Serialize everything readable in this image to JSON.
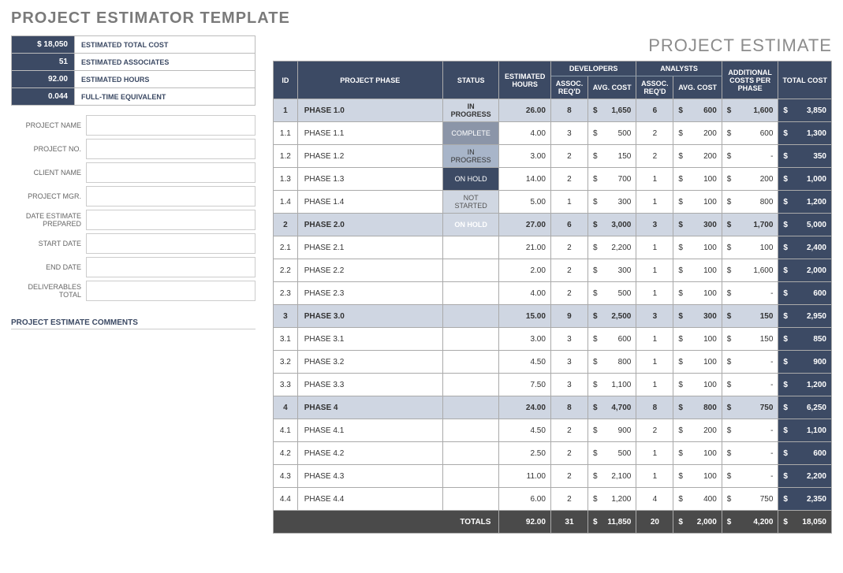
{
  "title": "PROJECT ESTIMATOR TEMPLATE",
  "estimate_title": "PROJECT ESTIMATE",
  "summary": [
    {
      "value": "$      18,050",
      "label": "ESTIMATED TOTAL COST"
    },
    {
      "value": "51",
      "label": "ESTIMATED ASSOCIATES"
    },
    {
      "value": "92.00",
      "label": "ESTIMATED HOURS"
    },
    {
      "value": "0.044",
      "label": "FULL-TIME EQUIVALENT"
    }
  ],
  "info_labels": [
    "PROJECT NAME",
    "PROJECT NO.",
    "CLIENT NAME",
    "PROJECT MGR.",
    "DATE ESTIMATE PREPARED",
    "START DATE",
    "END DATE",
    "DELIVERABLES TOTAL"
  ],
  "comments_label": "PROJECT ESTIMATE COMMENTS",
  "headers": {
    "id": "ID",
    "phase": "PROJECT PHASE",
    "status": "STATUS",
    "est": "ESTIMATED HOURS",
    "dev": "DEVELOPERS",
    "ana": "ANALYSTS",
    "assoc": "ASSOC. REQ'D",
    "avg": "AVG. COST",
    "addl": "ADDITIONAL COSTS PER PHASE",
    "total": "TOTAL COST"
  },
  "rows": [
    {
      "p": 1,
      "id": "1",
      "phase": "PHASE 1.0",
      "status": "IN PROGRESS",
      "scls": "s-inprog",
      "est": "26.00",
      "dassoc": "8",
      "davg": "1,650",
      "aassoc": "6",
      "aavg": "600",
      "addl": "1,600",
      "total": "3,850"
    },
    {
      "id": "1.1",
      "phase": "PHASE 1.1",
      "status": "COMPLETE",
      "scls": "s-complete",
      "est": "4.00",
      "dassoc": "3",
      "davg": "500",
      "aassoc": "2",
      "aavg": "200",
      "addl": "600",
      "total": "1,300"
    },
    {
      "id": "1.2",
      "phase": "PHASE 1.2",
      "status": "IN PROGRESS",
      "scls": "s-inprog",
      "est": "3.00",
      "dassoc": "2",
      "davg": "150",
      "aassoc": "2",
      "aavg": "200",
      "addl": "-",
      "total": "350"
    },
    {
      "id": "1.3",
      "phase": "PHASE 1.3",
      "status": "ON HOLD",
      "scls": "s-hold",
      "est": "14.00",
      "dassoc": "2",
      "davg": "700",
      "aassoc": "1",
      "aavg": "100",
      "addl": "200",
      "total": "1,000"
    },
    {
      "id": "1.4",
      "phase": "PHASE 1.4",
      "status": "NOT STARTED",
      "scls": "s-not",
      "est": "5.00",
      "dassoc": "1",
      "davg": "300",
      "aassoc": "1",
      "aavg": "100",
      "addl": "800",
      "total": "1,200"
    },
    {
      "p": 1,
      "id": "2",
      "phase": "PHASE 2.0",
      "status": "ON HOLD",
      "scls": "s-hold",
      "est": "27.00",
      "dassoc": "6",
      "davg": "3,000",
      "aassoc": "3",
      "aavg": "300",
      "addl": "1,700",
      "total": "5,000"
    },
    {
      "id": "2.1",
      "phase": "PHASE 2.1",
      "status": "",
      "est": "21.00",
      "dassoc": "2",
      "davg": "2,200",
      "aassoc": "1",
      "aavg": "100",
      "addl": "100",
      "total": "2,400"
    },
    {
      "id": "2.2",
      "phase": "PHASE 2.2",
      "status": "",
      "est": "2.00",
      "dassoc": "2",
      "davg": "300",
      "aassoc": "1",
      "aavg": "100",
      "addl": "1,600",
      "total": "2,000"
    },
    {
      "id": "2.3",
      "phase": "PHASE 2.3",
      "status": "",
      "est": "4.00",
      "dassoc": "2",
      "davg": "500",
      "aassoc": "1",
      "aavg": "100",
      "addl": "-",
      "total": "600"
    },
    {
      "p": 1,
      "id": "3",
      "phase": "PHASE 3.0",
      "status": "",
      "est": "15.00",
      "dassoc": "9",
      "davg": "2,500",
      "aassoc": "3",
      "aavg": "300",
      "addl": "150",
      "total": "2,950"
    },
    {
      "id": "3.1",
      "phase": "PHASE 3.1",
      "status": "",
      "est": "3.00",
      "dassoc": "3",
      "davg": "600",
      "aassoc": "1",
      "aavg": "100",
      "addl": "150",
      "total": "850"
    },
    {
      "id": "3.2",
      "phase": "PHASE 3.2",
      "status": "",
      "est": "4.50",
      "dassoc": "3",
      "davg": "800",
      "aassoc": "1",
      "aavg": "100",
      "addl": "-",
      "total": "900"
    },
    {
      "id": "3.3",
      "phase": "PHASE 3.3",
      "status": "",
      "est": "7.50",
      "dassoc": "3",
      "davg": "1,100",
      "aassoc": "1",
      "aavg": "100",
      "addl": "-",
      "total": "1,200"
    },
    {
      "p": 1,
      "id": "4",
      "phase": "PHASE 4",
      "status": "",
      "est": "24.00",
      "dassoc": "8",
      "davg": "4,700",
      "aassoc": "8",
      "aavg": "800",
      "addl": "750",
      "total": "6,250"
    },
    {
      "id": "4.1",
      "phase": "PHASE 4.1",
      "status": "",
      "est": "4.50",
      "dassoc": "2",
      "davg": "900",
      "aassoc": "2",
      "aavg": "200",
      "addl": "-",
      "total": "1,100"
    },
    {
      "id": "4.2",
      "phase": "PHASE 4.2",
      "status": "",
      "est": "2.50",
      "dassoc": "2",
      "davg": "500",
      "aassoc": "1",
      "aavg": "100",
      "addl": "-",
      "total": "600"
    },
    {
      "id": "4.3",
      "phase": "PHASE 4.3",
      "status": "",
      "est": "11.00",
      "dassoc": "2",
      "davg": "2,100",
      "aassoc": "1",
      "aavg": "100",
      "addl": "-",
      "total": "2,200"
    },
    {
      "id": "4.4",
      "phase": "PHASE 4.4",
      "status": "",
      "est": "6.00",
      "dassoc": "2",
      "davg": "1,200",
      "aassoc": "4",
      "aavg": "400",
      "addl": "750",
      "total": "2,350"
    }
  ],
  "totals": {
    "label": "TOTALS",
    "est": "92.00",
    "dassoc": "31",
    "davg": "11,850",
    "aassoc": "20",
    "aavg": "2,000",
    "addl": "4,200",
    "total": "18,050"
  }
}
